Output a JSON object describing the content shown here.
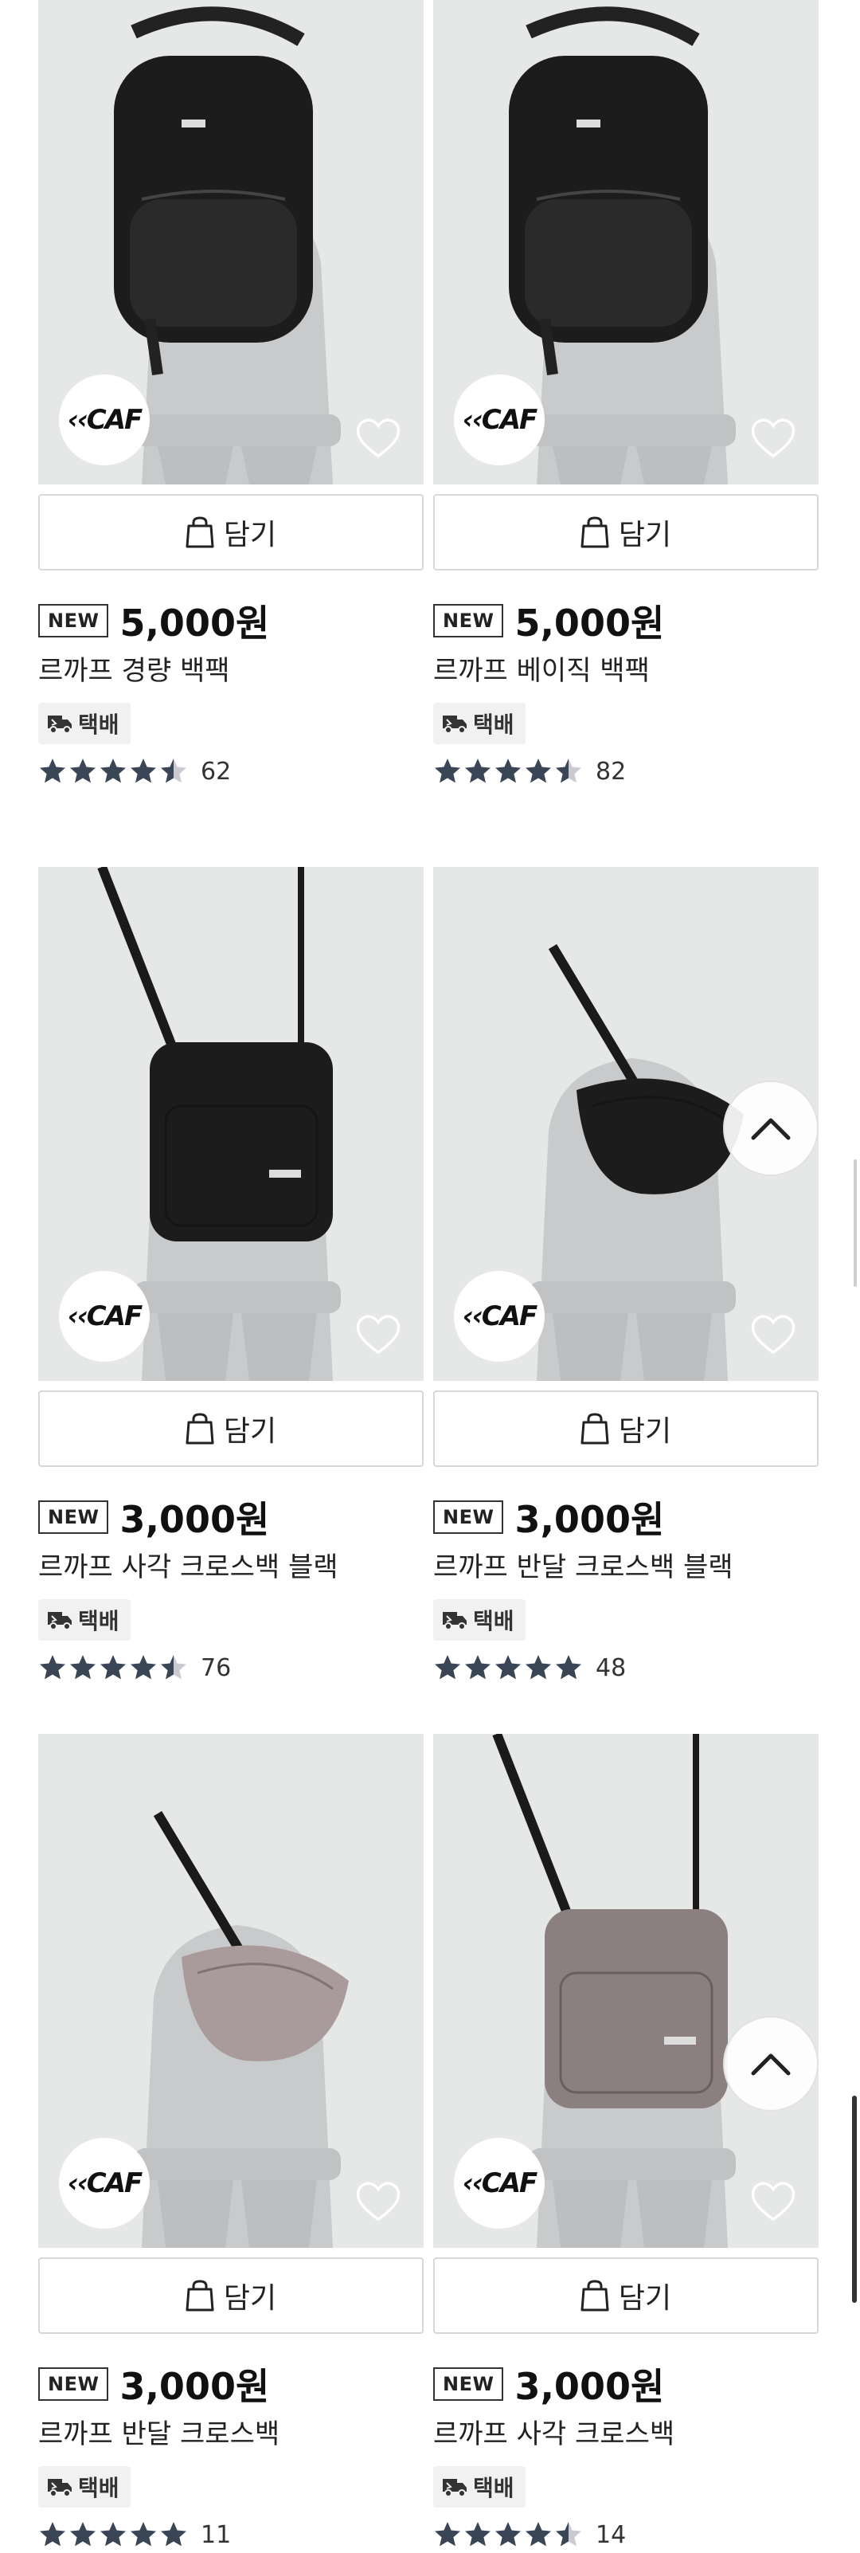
{
  "products": [
    {
      "price": "5,000원",
      "badge": "NEW",
      "name": "르까프 경량 백팩",
      "shipping": "택배",
      "rating": 4.5,
      "review_count": "62",
      "cart_label": "담기",
      "brand_logo": "CAF",
      "product_type": "backpack",
      "color": "#1c1c1c"
    },
    {
      "price": "5,000원",
      "badge": "NEW",
      "name": "르까프 베이직 백팩",
      "shipping": "택배",
      "rating": 4.5,
      "review_count": "82",
      "cart_label": "담기",
      "brand_logo": "CAF",
      "product_type": "backpack",
      "color": "#1c1c1c"
    },
    {
      "price": "3,000원",
      "badge": "NEW",
      "name": "르까프 사각 크로스백 블랙",
      "shipping": "택배",
      "rating": 4.5,
      "review_count": "76",
      "cart_label": "담기",
      "brand_logo": "CAF",
      "product_type": "square-crossbody",
      "color": "#1c1c1c"
    },
    {
      "price": "3,000원",
      "badge": "NEW",
      "name": "르까프 반달 크로스백 블랙",
      "shipping": "택배",
      "rating": 5,
      "review_count": "48",
      "cart_label": "담기",
      "brand_logo": "CAF",
      "product_type": "halfmoon-crossbody",
      "color": "#1c1c1c"
    },
    {
      "price": "3,000원",
      "badge": "NEW",
      "name": "르까프 반달 크로스백",
      "shipping": "택배",
      "rating": 5,
      "review_count": "11",
      "cart_label": "담기",
      "brand_logo": "CAF",
      "product_type": "halfmoon-crossbody",
      "color": "#a99a9c"
    },
    {
      "price": "3,000원",
      "badge": "NEW",
      "name": "르까프 사각 크로스백",
      "shipping": "택배",
      "rating": 4.5,
      "review_count": "14",
      "cart_label": "담기",
      "brand_logo": "CAF",
      "product_type": "square-crossbody",
      "color": "#8c7f7f"
    }
  ],
  "icons": {
    "cart": "shopping-bag-icon",
    "wishlist": "heart-outline-icon",
    "shipping": "delivery-truck-icon",
    "star": "star-icon",
    "scroll_top": "chevron-up-icon"
  },
  "colors": {
    "star": "#3a4556",
    "star_empty": "#c8ccd2",
    "badge_border": "#333333",
    "button_border": "#d8d8d8"
  }
}
